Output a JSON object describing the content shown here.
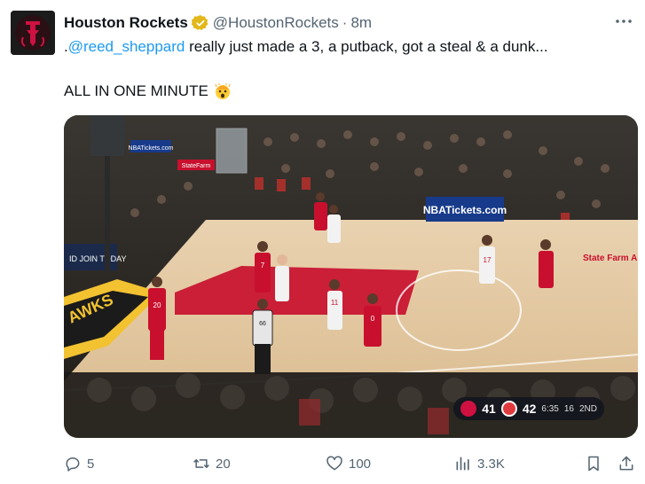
{
  "account": {
    "name": "Houston Rockets",
    "handle": "@HoustonRockets",
    "separator": "·",
    "time": "8m"
  },
  "tweet": {
    "prefix": ".",
    "mention": "@reed_sheppard",
    "text": " really just made a 3, a putback, got a steal & a dunk...",
    "line2": "ALL IN ONE MINUTE"
  },
  "media": {
    "ads": [
      "NBATickets.com",
      "NBATickets.com",
      "StateFarm",
      "State Farm ARENA",
      "ID JOIN TODAY"
    ],
    "court_text": "AWKS",
    "jerseys": [
      "17",
      "7",
      "20",
      "11",
      "0",
      "66"
    ],
    "scorebug": {
      "home_score": "41",
      "away_score": "42",
      "clock": "6:35",
      "shot_clock": "16",
      "period": "2ND"
    }
  },
  "actions": {
    "replies": "5",
    "retweets": "20",
    "likes": "100",
    "views": "3.3K"
  },
  "colors": {
    "rockets_red": "#ce1141",
    "link_blue": "#1d9bf0",
    "verified_gold": "#e2b719",
    "muted": "#536471"
  }
}
